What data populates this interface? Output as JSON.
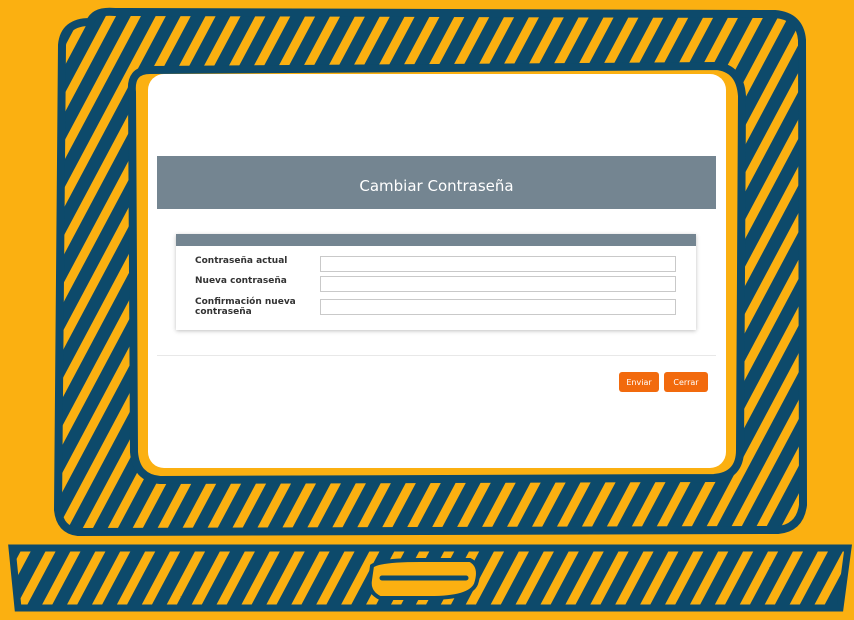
{
  "dialog": {
    "title": "Cambiar Contraseña",
    "fields": [
      {
        "label": "Contraseña actual",
        "value": ""
      },
      {
        "label": "Nueva contraseña",
        "value": ""
      },
      {
        "label": "Confirmación nueva contraseña",
        "value": ""
      }
    ],
    "buttons": {
      "submit": "Enviar",
      "close": "Cerrar"
    }
  },
  "colors": {
    "background": "#fbb011",
    "frame": "#0d4a6b",
    "title_bar": "#748591",
    "button": "#f26a0d"
  },
  "illustration": "laptop-sketch"
}
